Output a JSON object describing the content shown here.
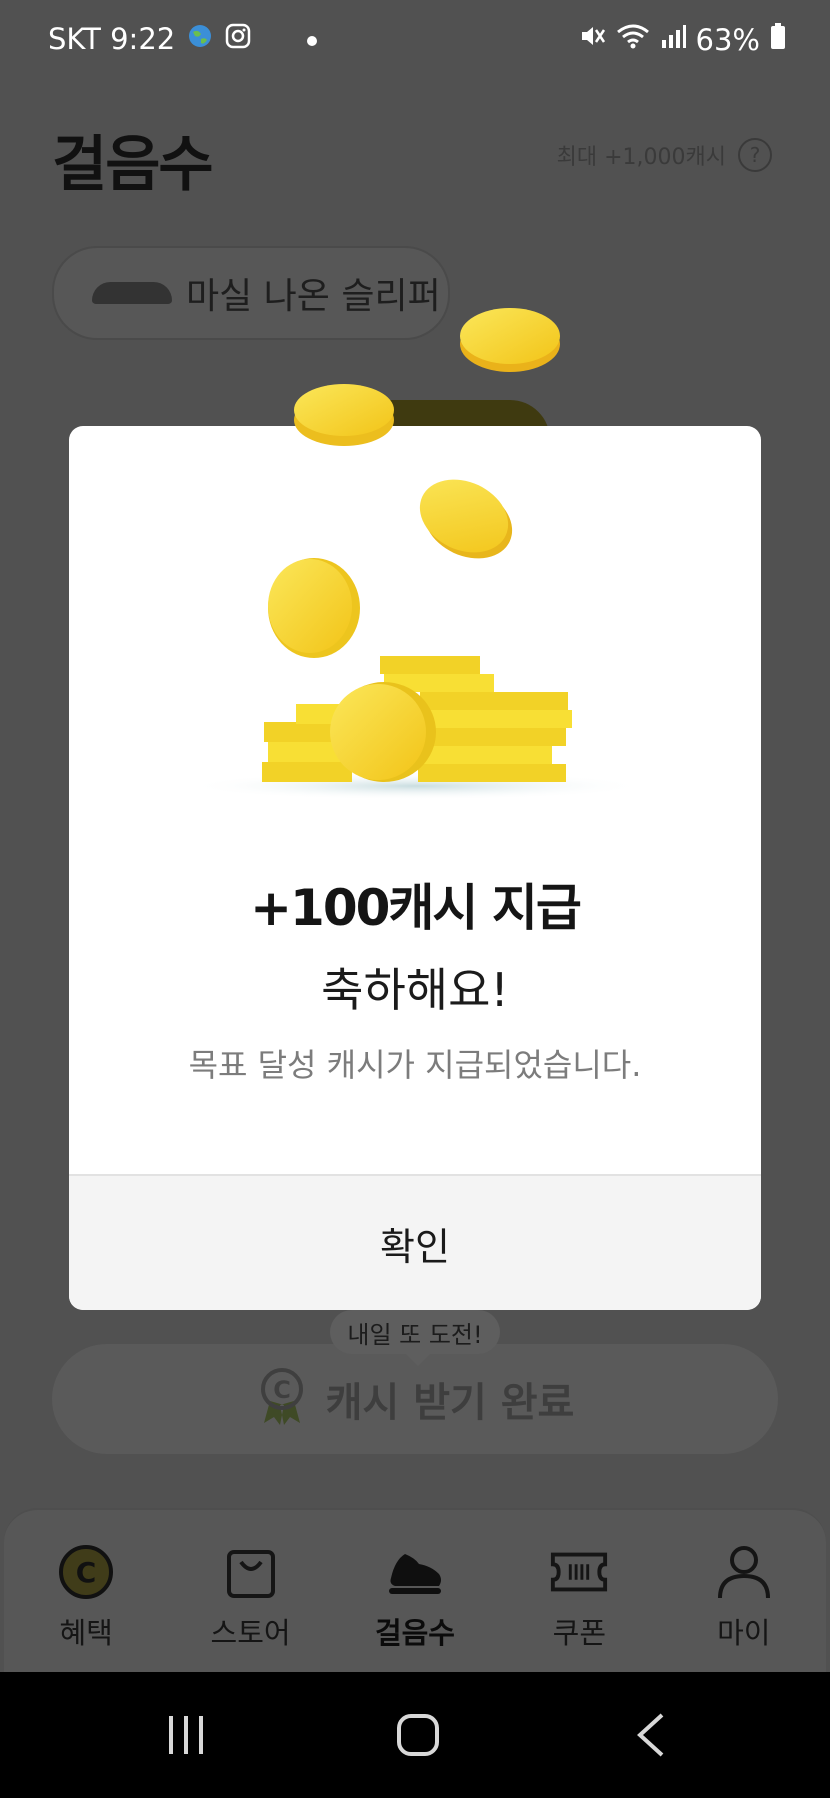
{
  "status_bar": {
    "carrier_time": "SKT 9:22",
    "battery": "63%"
  },
  "page": {
    "title": "걸음수",
    "max_cash": "최대 +1,000캐시",
    "help_glyph": "?",
    "slipper_label": "마실 나온 슬리퍼",
    "tooltip": "내일 또 도전!",
    "cash_done_label": "캐시 받기 완료"
  },
  "tabs": [
    {
      "label": "혜택",
      "icon": "cash-c-icon"
    },
    {
      "label": "스토어",
      "icon": "shopping-bag-icon"
    },
    {
      "label": "걸음수",
      "icon": "sneaker-icon",
      "active": true
    },
    {
      "label": "쿠폰",
      "icon": "ticket-icon"
    },
    {
      "label": "마이",
      "icon": "person-icon"
    }
  ],
  "modal": {
    "title": "+100캐시 지급",
    "subtitle": "축하해요!",
    "description": "목표 달성 캐시가 지급되었습니다.",
    "confirm_label": "확인"
  },
  "colors": {
    "dim_overlay": "#515151",
    "coin_yellow": "#f5d531",
    "modal_bg": "#ffffff",
    "footer_bg": "#f4f4f4"
  }
}
